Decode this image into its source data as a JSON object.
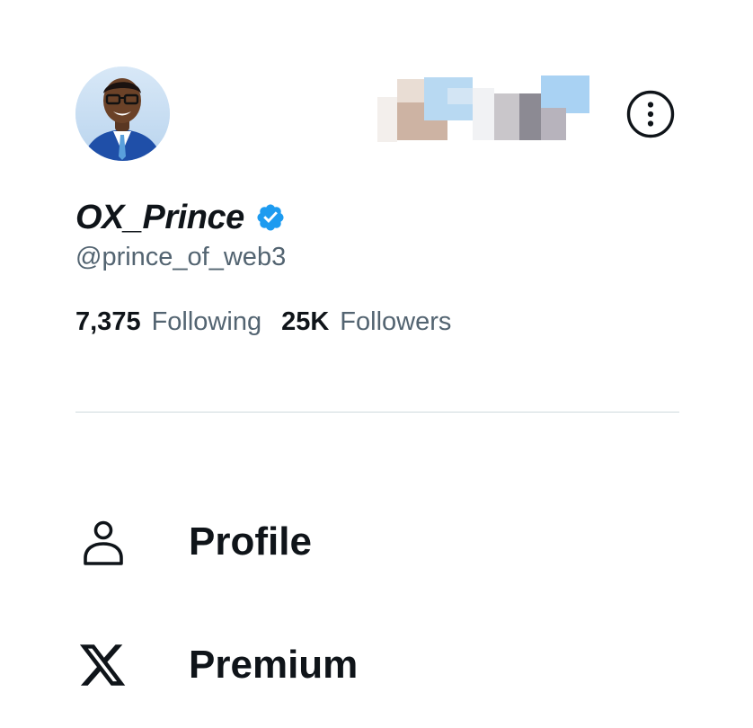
{
  "profile": {
    "display_name": "OX_Prince",
    "handle": "@prince_of_web3",
    "verified": true,
    "verified_badge_color": "#1d9bf0",
    "following_count": "7,375",
    "following_label": "Following",
    "followers_count": "25K",
    "followers_label": "Followers"
  },
  "header": {
    "more_icon": "more-vertical-circle-icon",
    "account_switcher": "blurred-account-avatars"
  },
  "menu": {
    "items": [
      {
        "label": "Profile",
        "icon": "person-icon"
      },
      {
        "label": "Premium",
        "icon": "x-logo-icon"
      }
    ]
  },
  "colors": {
    "text_primary": "#0f1419",
    "text_secondary": "#536471",
    "divider": "#cfd9de",
    "accent": "#1d9bf0"
  }
}
